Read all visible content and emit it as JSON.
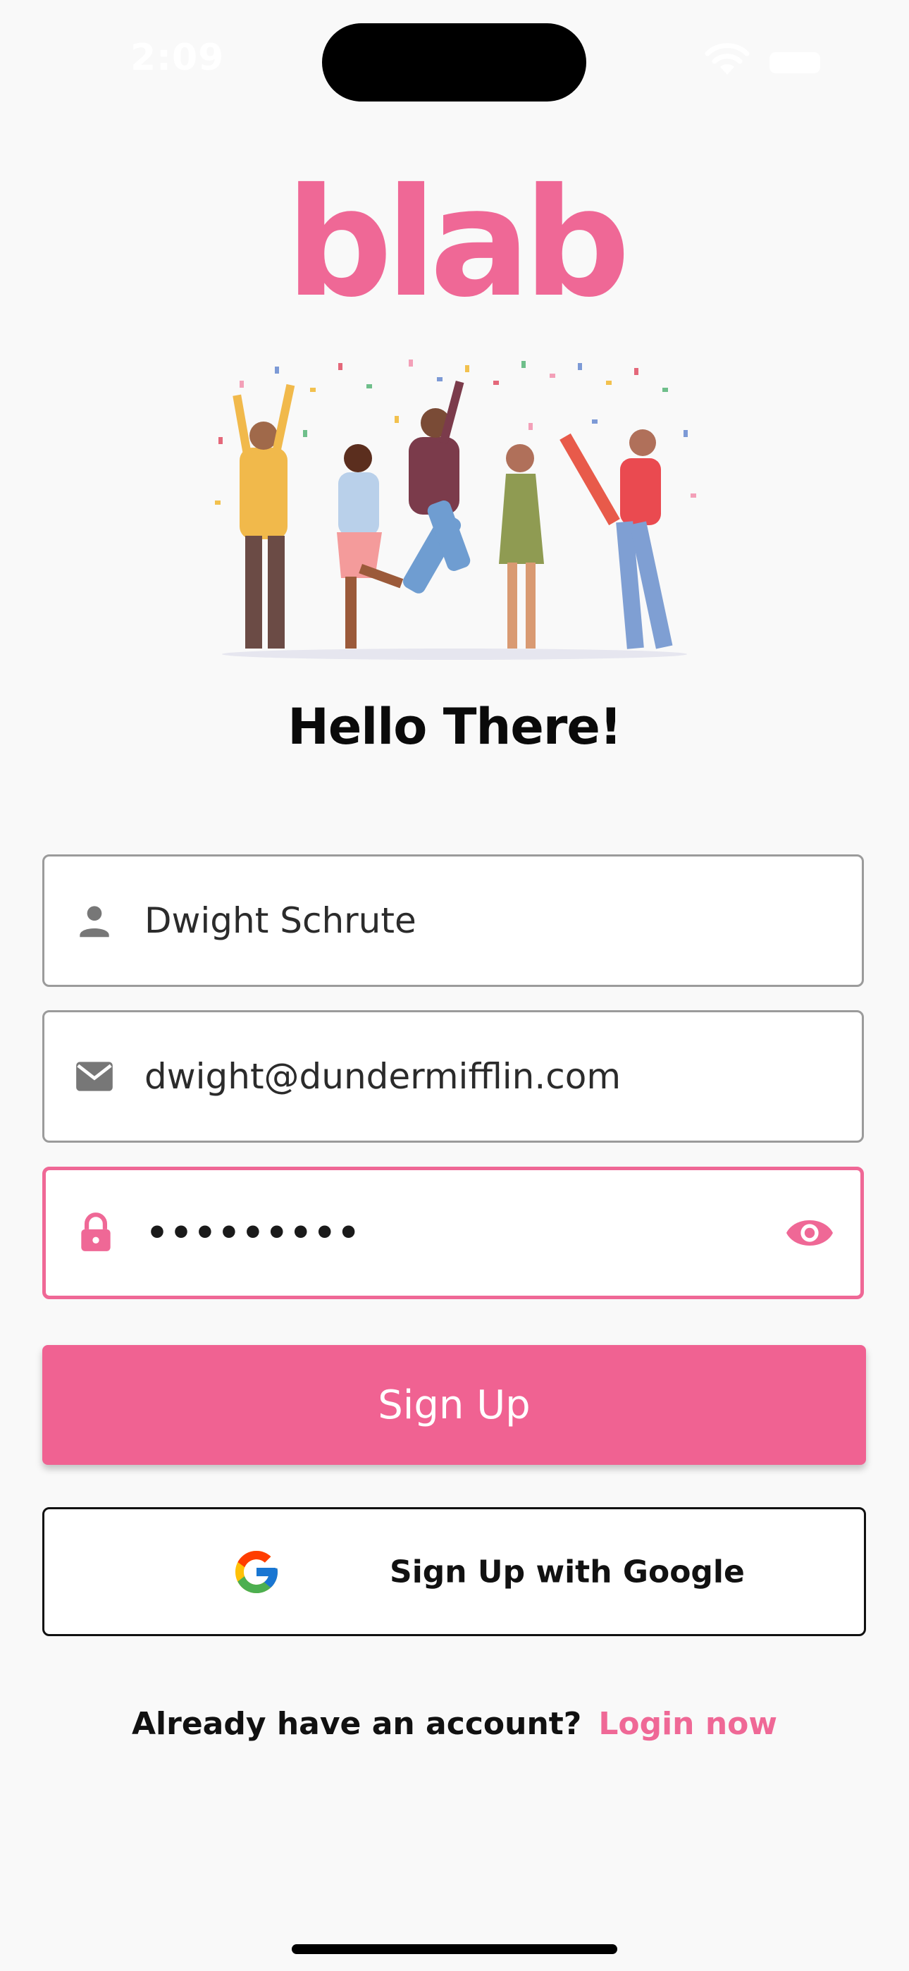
{
  "status_bar": {
    "time": "2:09"
  },
  "app": {
    "logo_text": "blab"
  },
  "heading": "Hello There!",
  "fields": {
    "name": {
      "value": "Dwight Schrute",
      "icon": "person-icon"
    },
    "email": {
      "value": "dwight@dundermifflin.com",
      "icon": "mail-icon"
    },
    "password": {
      "value": "•••••••••",
      "icon": "lock-icon",
      "toggle_icon": "eye-icon"
    }
  },
  "buttons": {
    "signup": "Sign Up",
    "google": "Sign Up with Google"
  },
  "footer": {
    "question": "Already have an account?",
    "link": "Login now"
  },
  "colors": {
    "accent": "#ef6896",
    "button": "#f06292",
    "background": "#f9f9f9"
  }
}
